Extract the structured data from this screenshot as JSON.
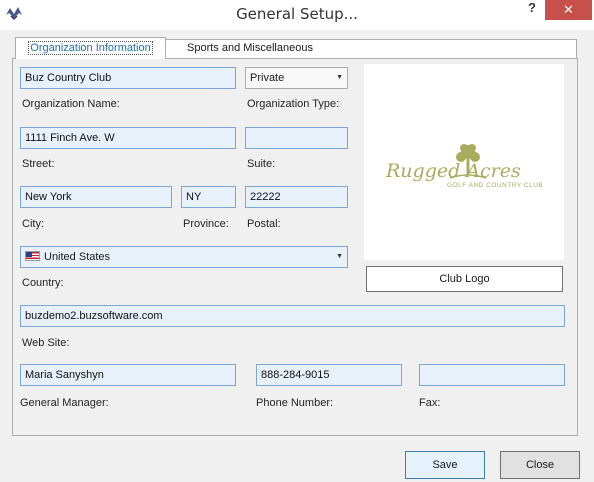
{
  "window": {
    "title": "General Setup...",
    "help_label": "?",
    "close_label": "✕"
  },
  "tabs": [
    {
      "label": "Organization Information",
      "active": true
    },
    {
      "label": "Sports and Miscellaneous",
      "active": false
    }
  ],
  "form": {
    "org_name": {
      "value": "Buz Country Club",
      "label": "Organization Name:"
    },
    "org_type": {
      "value": "Private",
      "label": "Organization Type:"
    },
    "street": {
      "value": "1111 Finch Ave. W",
      "label": "Street:"
    },
    "suite": {
      "value": "",
      "label": "Suite:"
    },
    "city": {
      "value": "New York",
      "label": "City:"
    },
    "province": {
      "value": "NY",
      "label": "Province:"
    },
    "postal": {
      "value": "22222",
      "label": "Postal:"
    },
    "country": {
      "value": "United States",
      "label": "Country:",
      "flag": "us-flag"
    },
    "website": {
      "value": "buzdemo2.buzsoftware.com",
      "label": "Web Site:"
    },
    "general_manager": {
      "value": "Maria Sanyshyn",
      "label": "General Manager:"
    },
    "phone": {
      "value": "888-284-9015",
      "label": "Phone Number:"
    },
    "fax": {
      "value": "",
      "label": "Fax:"
    }
  },
  "logo": {
    "line1": "Rugged Acres",
    "line2": "GOLF AND COUNTRY CLUB",
    "button_label": "Club Logo",
    "color": "#a7ad5c"
  },
  "buttons": {
    "save": "Save",
    "close": "Close"
  }
}
